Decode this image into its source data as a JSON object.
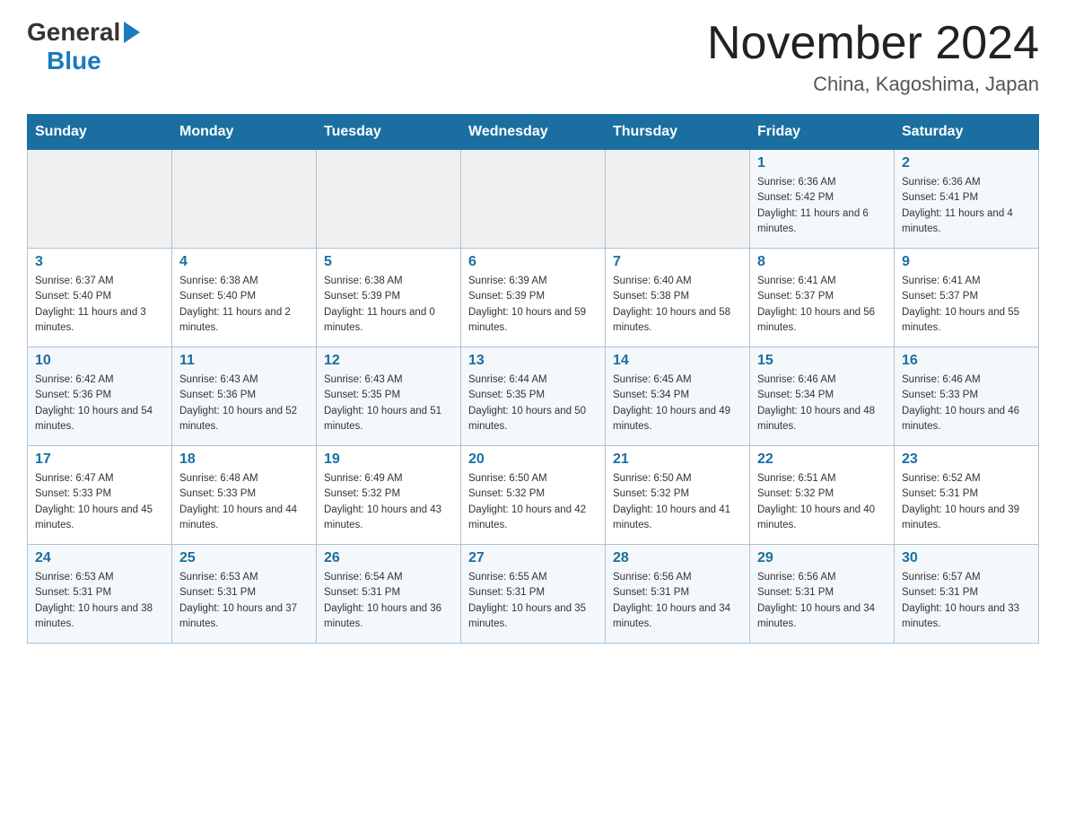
{
  "logo": {
    "general": "General",
    "blue": "Blue"
  },
  "title": "November 2024",
  "subtitle": "China, Kagoshima, Japan",
  "weekdays": [
    "Sunday",
    "Monday",
    "Tuesday",
    "Wednesday",
    "Thursday",
    "Friday",
    "Saturday"
  ],
  "weeks": [
    [
      {
        "day": "",
        "sunrise": "",
        "sunset": "",
        "daylight": ""
      },
      {
        "day": "",
        "sunrise": "",
        "sunset": "",
        "daylight": ""
      },
      {
        "day": "",
        "sunrise": "",
        "sunset": "",
        "daylight": ""
      },
      {
        "day": "",
        "sunrise": "",
        "sunset": "",
        "daylight": ""
      },
      {
        "day": "",
        "sunrise": "",
        "sunset": "",
        "daylight": ""
      },
      {
        "day": "1",
        "sunrise": "Sunrise: 6:36 AM",
        "sunset": "Sunset: 5:42 PM",
        "daylight": "Daylight: 11 hours and 6 minutes."
      },
      {
        "day": "2",
        "sunrise": "Sunrise: 6:36 AM",
        "sunset": "Sunset: 5:41 PM",
        "daylight": "Daylight: 11 hours and 4 minutes."
      }
    ],
    [
      {
        "day": "3",
        "sunrise": "Sunrise: 6:37 AM",
        "sunset": "Sunset: 5:40 PM",
        "daylight": "Daylight: 11 hours and 3 minutes."
      },
      {
        "day": "4",
        "sunrise": "Sunrise: 6:38 AM",
        "sunset": "Sunset: 5:40 PM",
        "daylight": "Daylight: 11 hours and 2 minutes."
      },
      {
        "day": "5",
        "sunrise": "Sunrise: 6:38 AM",
        "sunset": "Sunset: 5:39 PM",
        "daylight": "Daylight: 11 hours and 0 minutes."
      },
      {
        "day": "6",
        "sunrise": "Sunrise: 6:39 AM",
        "sunset": "Sunset: 5:39 PM",
        "daylight": "Daylight: 10 hours and 59 minutes."
      },
      {
        "day": "7",
        "sunrise": "Sunrise: 6:40 AM",
        "sunset": "Sunset: 5:38 PM",
        "daylight": "Daylight: 10 hours and 58 minutes."
      },
      {
        "day": "8",
        "sunrise": "Sunrise: 6:41 AM",
        "sunset": "Sunset: 5:37 PM",
        "daylight": "Daylight: 10 hours and 56 minutes."
      },
      {
        "day": "9",
        "sunrise": "Sunrise: 6:41 AM",
        "sunset": "Sunset: 5:37 PM",
        "daylight": "Daylight: 10 hours and 55 minutes."
      }
    ],
    [
      {
        "day": "10",
        "sunrise": "Sunrise: 6:42 AM",
        "sunset": "Sunset: 5:36 PM",
        "daylight": "Daylight: 10 hours and 54 minutes."
      },
      {
        "day": "11",
        "sunrise": "Sunrise: 6:43 AM",
        "sunset": "Sunset: 5:36 PM",
        "daylight": "Daylight: 10 hours and 52 minutes."
      },
      {
        "day": "12",
        "sunrise": "Sunrise: 6:43 AM",
        "sunset": "Sunset: 5:35 PM",
        "daylight": "Daylight: 10 hours and 51 minutes."
      },
      {
        "day": "13",
        "sunrise": "Sunrise: 6:44 AM",
        "sunset": "Sunset: 5:35 PM",
        "daylight": "Daylight: 10 hours and 50 minutes."
      },
      {
        "day": "14",
        "sunrise": "Sunrise: 6:45 AM",
        "sunset": "Sunset: 5:34 PM",
        "daylight": "Daylight: 10 hours and 49 minutes."
      },
      {
        "day": "15",
        "sunrise": "Sunrise: 6:46 AM",
        "sunset": "Sunset: 5:34 PM",
        "daylight": "Daylight: 10 hours and 48 minutes."
      },
      {
        "day": "16",
        "sunrise": "Sunrise: 6:46 AM",
        "sunset": "Sunset: 5:33 PM",
        "daylight": "Daylight: 10 hours and 46 minutes."
      }
    ],
    [
      {
        "day": "17",
        "sunrise": "Sunrise: 6:47 AM",
        "sunset": "Sunset: 5:33 PM",
        "daylight": "Daylight: 10 hours and 45 minutes."
      },
      {
        "day": "18",
        "sunrise": "Sunrise: 6:48 AM",
        "sunset": "Sunset: 5:33 PM",
        "daylight": "Daylight: 10 hours and 44 minutes."
      },
      {
        "day": "19",
        "sunrise": "Sunrise: 6:49 AM",
        "sunset": "Sunset: 5:32 PM",
        "daylight": "Daylight: 10 hours and 43 minutes."
      },
      {
        "day": "20",
        "sunrise": "Sunrise: 6:50 AM",
        "sunset": "Sunset: 5:32 PM",
        "daylight": "Daylight: 10 hours and 42 minutes."
      },
      {
        "day": "21",
        "sunrise": "Sunrise: 6:50 AM",
        "sunset": "Sunset: 5:32 PM",
        "daylight": "Daylight: 10 hours and 41 minutes."
      },
      {
        "day": "22",
        "sunrise": "Sunrise: 6:51 AM",
        "sunset": "Sunset: 5:32 PM",
        "daylight": "Daylight: 10 hours and 40 minutes."
      },
      {
        "day": "23",
        "sunrise": "Sunrise: 6:52 AM",
        "sunset": "Sunset: 5:31 PM",
        "daylight": "Daylight: 10 hours and 39 minutes."
      }
    ],
    [
      {
        "day": "24",
        "sunrise": "Sunrise: 6:53 AM",
        "sunset": "Sunset: 5:31 PM",
        "daylight": "Daylight: 10 hours and 38 minutes."
      },
      {
        "day": "25",
        "sunrise": "Sunrise: 6:53 AM",
        "sunset": "Sunset: 5:31 PM",
        "daylight": "Daylight: 10 hours and 37 minutes."
      },
      {
        "day": "26",
        "sunrise": "Sunrise: 6:54 AM",
        "sunset": "Sunset: 5:31 PM",
        "daylight": "Daylight: 10 hours and 36 minutes."
      },
      {
        "day": "27",
        "sunrise": "Sunrise: 6:55 AM",
        "sunset": "Sunset: 5:31 PM",
        "daylight": "Daylight: 10 hours and 35 minutes."
      },
      {
        "day": "28",
        "sunrise": "Sunrise: 6:56 AM",
        "sunset": "Sunset: 5:31 PM",
        "daylight": "Daylight: 10 hours and 34 minutes."
      },
      {
        "day": "29",
        "sunrise": "Sunrise: 6:56 AM",
        "sunset": "Sunset: 5:31 PM",
        "daylight": "Daylight: 10 hours and 34 minutes."
      },
      {
        "day": "30",
        "sunrise": "Sunrise: 6:57 AM",
        "sunset": "Sunset: 5:31 PM",
        "daylight": "Daylight: 10 hours and 33 minutes."
      }
    ]
  ]
}
